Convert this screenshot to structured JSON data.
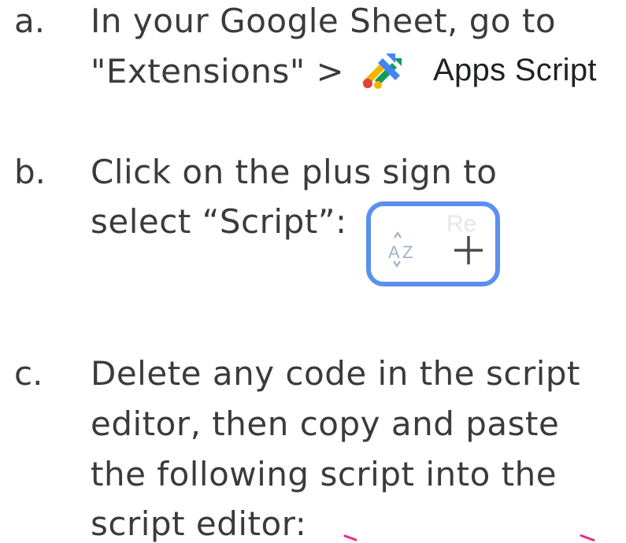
{
  "steps": [
    {
      "marker": "a.",
      "lines": [
        "In your Google Sheet, go to",
        "\"Extensions\" >"
      ],
      "menu_item": {
        "icon": "apps-script-logo-icon",
        "label": "Apps Script"
      }
    },
    {
      "marker": "b.",
      "lines": [
        "Click on the plus sign to",
        "select “Script”:"
      ],
      "toolbar": {
        "sort_icon": "sort-az-icon",
        "faded_text": "Re",
        "plus_icon": "plus-icon",
        "highlight_color": "#5b8ff0"
      }
    },
    {
      "marker": "c.",
      "lines": [
        "Delete any code in the script",
        "editor, then copy and paste",
        "the following script into the",
        "script editor:"
      ]
    }
  ],
  "colors": {
    "text": "#3b3b3b",
    "accent_pink": "#e3338a"
  }
}
